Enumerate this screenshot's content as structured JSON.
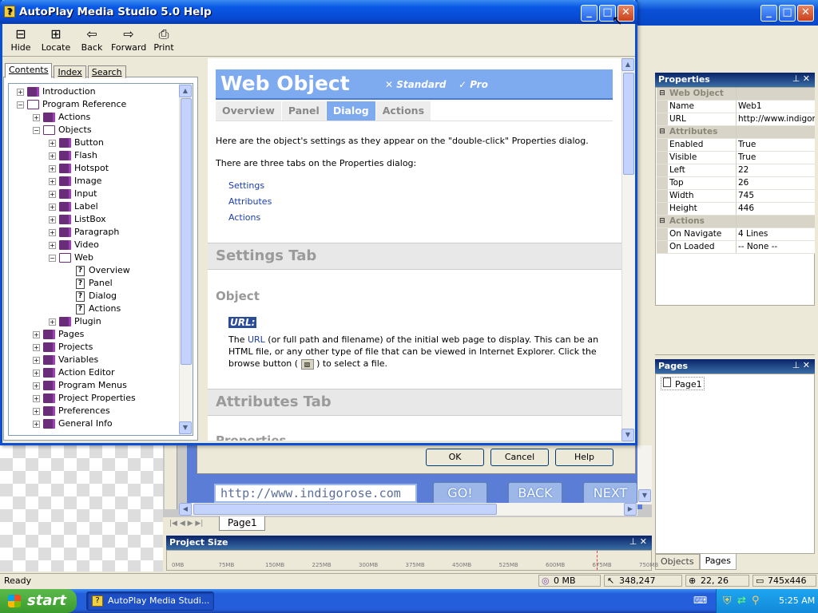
{
  "background_app": {
    "properties_title": "Properties",
    "properties": [
      {
        "group": true,
        "key": "Web Object",
        "value": ""
      },
      {
        "key": "Name",
        "value": "Web1"
      },
      {
        "key": "URL",
        "value": "http://www.indigorose"
      },
      {
        "group": true,
        "key": "Attributes",
        "value": ""
      },
      {
        "key": "Enabled",
        "value": "True"
      },
      {
        "key": "Visible",
        "value": "True"
      },
      {
        "key": "Left",
        "value": "22"
      },
      {
        "key": "Top",
        "value": "26"
      },
      {
        "key": "Width",
        "value": "745"
      },
      {
        "key": "Height",
        "value": "446"
      },
      {
        "group": true,
        "key": "Actions",
        "value": ""
      },
      {
        "key": "On Navigate",
        "value": "4 Lines"
      },
      {
        "key": "On Loaded",
        "value": "-- None --"
      }
    ],
    "pages_title": "Pages",
    "pages_item": "Page1",
    "bottom_tabs": [
      "Objects",
      "Pages"
    ],
    "dialog_buttons": {
      "ok": "OK",
      "cancel": "Cancel",
      "help": "Help"
    },
    "url_field": "http://www.indigorose.com",
    "go": "GO!",
    "back": "BACK",
    "next": "NEXT",
    "page_tab": "Page1",
    "project_size_title": "Project Size",
    "ruler": [
      "0MB",
      "75MB",
      "150MB",
      "225MB",
      "300MB",
      "375MB",
      "450MB",
      "525MB",
      "600MB",
      "675MB",
      "750MB"
    ],
    "status": {
      "ready": "Ready",
      "size": "0 MB",
      "cursor": "348,247",
      "pos": "22, 26",
      "dims": "745x446"
    }
  },
  "taskbar": {
    "start": "start",
    "task": "AutoPlay Media Studi...",
    "time": "5:25 AM"
  },
  "help": {
    "title": "AutoPlay Media Studio 5.0 Help",
    "toolbar": [
      "Hide",
      "Locate",
      "Back",
      "Forward",
      "Print"
    ],
    "tabs": [
      "Contents",
      "Index",
      "Search"
    ],
    "tree": {
      "introduction": "Introduction",
      "program_reference": "Program Reference",
      "actions": "Actions",
      "objects": "Objects",
      "object_items": [
        "Button",
        "Flash",
        "Hotspot",
        "Image",
        "Input",
        "Label",
        "ListBox",
        "Paragraph",
        "Video"
      ],
      "web": "Web",
      "web_pages": [
        "Overview",
        "Panel",
        "Dialog",
        "Actions"
      ],
      "plugin": "Plugin",
      "more": [
        "Pages",
        "Projects",
        "Variables",
        "Action Editor",
        "Program Menus",
        "Project Properties",
        "Preferences",
        "General Info"
      ]
    },
    "content": {
      "heading": "Web Object",
      "editions": [
        "Standard",
        "Pro"
      ],
      "ctabs": [
        "Overview",
        "Panel",
        "Dialog",
        "Actions"
      ],
      "intro": "Here are the object's settings as they appear on the \"double-click\" Properties dialog.",
      "three_tabs": "There are three tabs on the Properties dialog:",
      "links": [
        "Settings",
        "Attributes",
        "Actions"
      ],
      "settings_tab": "Settings Tab",
      "object_heading": "Object",
      "url_label": "URL:",
      "url_text_before": "The ",
      "url_link": "URL",
      "url_text_after": " (or full path and filename) of the initial web page to display. This can be an HTML file, or any other type of file that can be viewed in Internet Explorer. Click the browse button (",
      "url_text_end": ") to select a file.",
      "attributes_tab": "Attributes Tab",
      "properties_partial": "Properties"
    }
  }
}
